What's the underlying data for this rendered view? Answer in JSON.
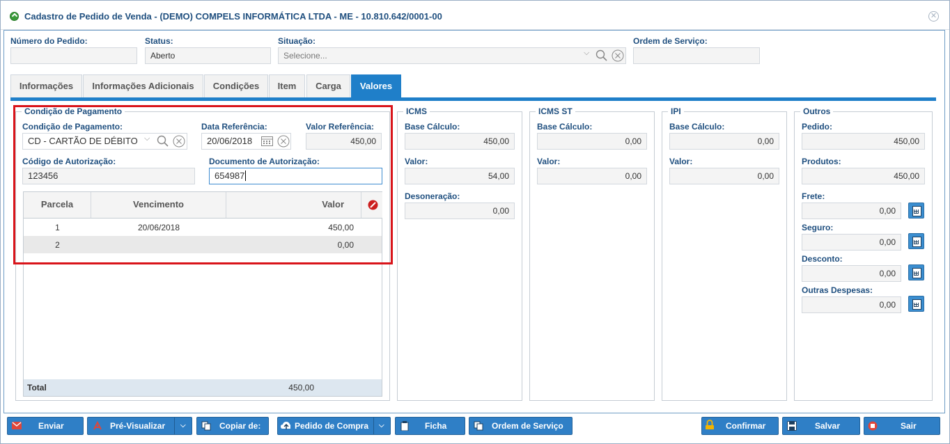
{
  "window": {
    "title": "Cadastro de Pedido de Venda - (DEMO) COMPELS INFORMÁTICA LTDA - ME - 10.810.642/0001-00"
  },
  "header": {
    "numero_label": "Número do Pedido:",
    "numero_value": "",
    "status_label": "Status:",
    "status_value": "Aberto",
    "situacao_label": "Situação:",
    "situacao_placeholder": "Selecione...",
    "os_label": "Ordem de Serviço:",
    "os_value": ""
  },
  "tabs": [
    "Informações",
    "Informações Adicionais",
    "Condições",
    "Item",
    "Carga",
    "Valores"
  ],
  "active_tab": "Valores",
  "condicao": {
    "legend": "Condição de Pagamento",
    "condicao_label": "Condição de Pagamento:",
    "condicao_value": "CD - CARTÃO DE DÉBITO",
    "data_label": "Data Referência:",
    "data_value": "20/06/2018",
    "valor_label": "Valor Referência:",
    "valor_value": "450,00",
    "codigo_label": "Código de Autorização:",
    "codigo_value": "123456",
    "documento_label": "Documento de Autorização:",
    "documento_value": "654987"
  },
  "parcelas": {
    "headers": [
      "Parcela",
      "Vencimento",
      "Valor"
    ],
    "rows": [
      {
        "parcela": "1",
        "vencimento": "20/06/2018",
        "valor": "450,00"
      },
      {
        "parcela": "2",
        "vencimento": "",
        "valor": "0,00"
      }
    ],
    "total_label": "Total",
    "total_value": "450,00"
  },
  "icms": {
    "legend": "ICMS",
    "base_label": "Base Cálculo:",
    "base_value": "450,00",
    "valor_label": "Valor:",
    "valor_value": "54,00",
    "deson_label": "Desoneração:",
    "deson_value": "0,00"
  },
  "icms_st": {
    "legend": "ICMS ST",
    "base_label": "Base Cálculo:",
    "base_value": "0,00",
    "valor_label": "Valor:",
    "valor_value": "0,00"
  },
  "ipi": {
    "legend": "IPI",
    "base_label": "Base Cálculo:",
    "base_value": "0,00",
    "valor_label": "Valor:",
    "valor_value": "0,00"
  },
  "outros": {
    "legend": "Outros",
    "pedido_label": "Pedido:",
    "pedido_value": "450,00",
    "produtos_label": "Produtos:",
    "produtos_value": "450,00",
    "frete_label": "Frete:",
    "frete_value": "0,00",
    "seguro_label": "Seguro:",
    "seguro_value": "0,00",
    "desconto_label": "Desconto:",
    "desconto_value": "0,00",
    "despesas_label": "Outras Despesas:",
    "despesas_value": "0,00"
  },
  "footer": {
    "enviar": "Enviar",
    "previsualizar": "Pré-Visualizar",
    "copiar": "Copiar de:",
    "pedido_compra": "Pedido de Compra",
    "ficha": "Ficha",
    "ordem_servico": "Ordem de Serviço",
    "confirmar": "Confirmar",
    "salvar": "Salvar",
    "sair": "Sair"
  },
  "colors": {
    "accent": "#1f7fc9",
    "label": "#1f4f7f",
    "highlight": "#d9141a"
  }
}
